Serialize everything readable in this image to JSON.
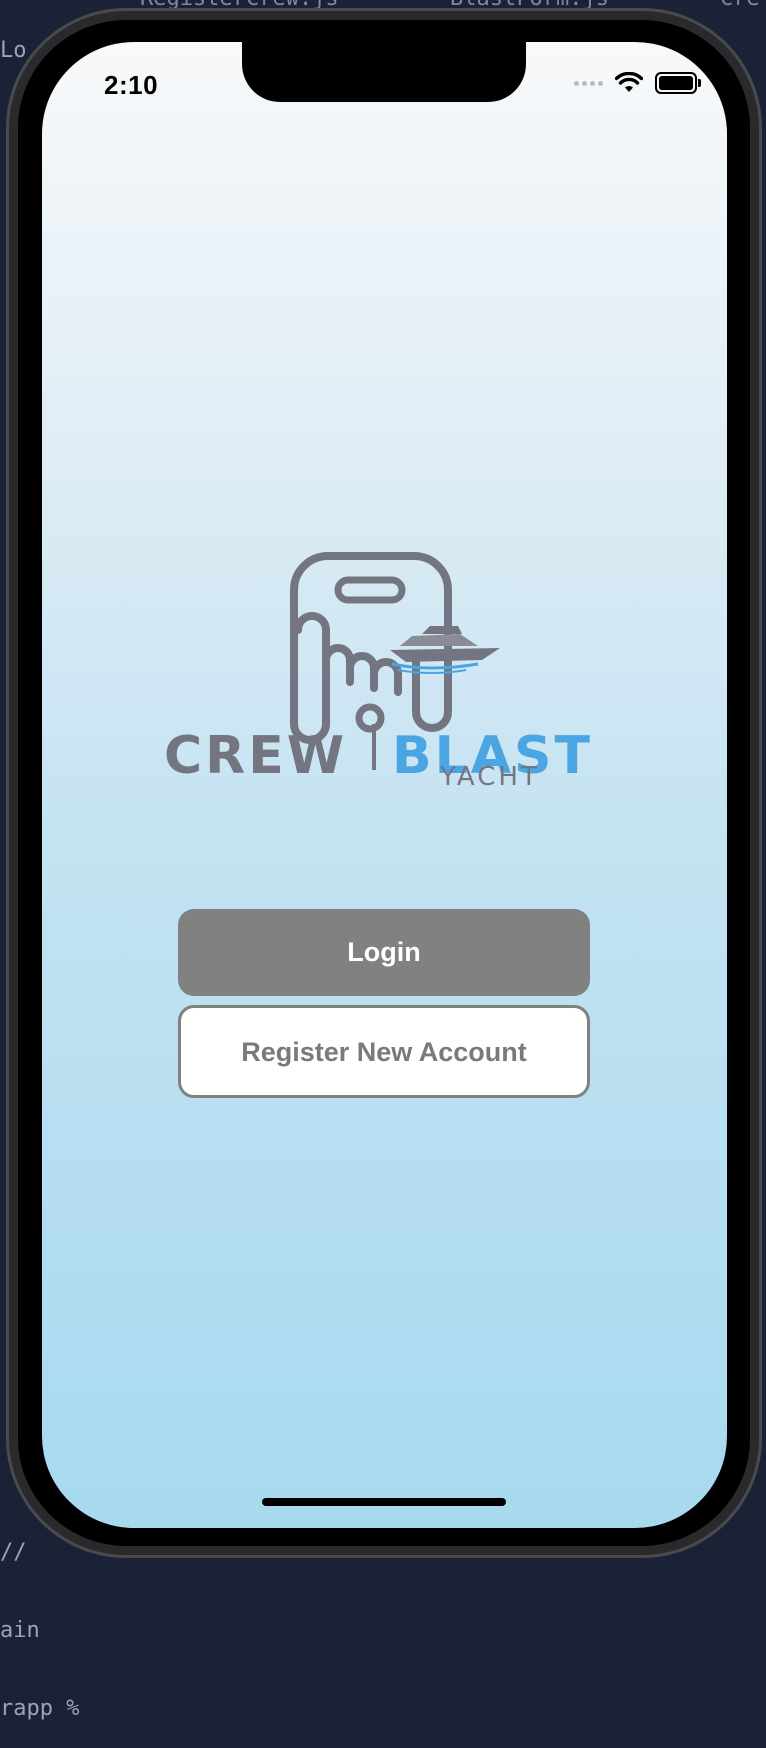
{
  "background_ide": {
    "tab_1": "RegisterCrew.js",
    "tab_2": "BlastForm.js",
    "tab_3": "Cre",
    "left_text": "Lo",
    "bottom_lines": [
      "//",
      "ain",
      "rapp %"
    ]
  },
  "status_bar": {
    "time": "2:10"
  },
  "logo": {
    "crew": "CREW",
    "blast": "BLAST",
    "yacht": "YACHT"
  },
  "buttons": {
    "login": "Login",
    "register": "Register New Account"
  },
  "colors": {
    "brand_gray": "#737580",
    "brand_blue": "#4aa6e2",
    "login_bg": "#818181"
  }
}
